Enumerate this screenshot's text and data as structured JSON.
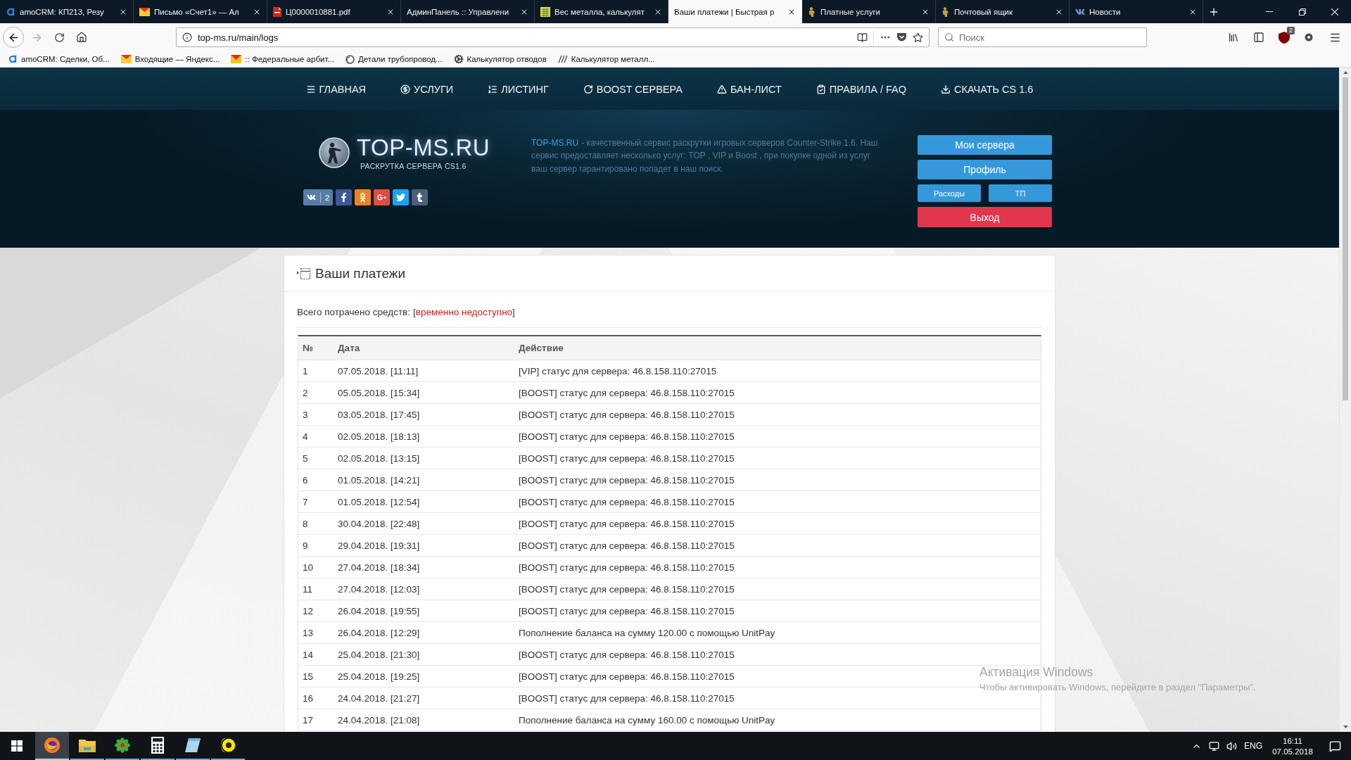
{
  "browser": {
    "tabs": [
      {
        "title": "amoCRM: КП213, Резу",
        "selected": false
      },
      {
        "title": "Письмо «Счет1» — Ал",
        "selected": false
      },
      {
        "title": "Ц0000010881.pdf",
        "selected": false
      },
      {
        "title": "АдминПанель :: Управлени",
        "selected": false
      },
      {
        "title": "Вес металла, калькулят",
        "selected": false
      },
      {
        "title": "Ваши платежи | Быстрая р",
        "selected": true
      },
      {
        "title": "Платные услуги",
        "selected": false
      },
      {
        "title": "Почтовый ящик",
        "selected": false
      },
      {
        "title": "Новости",
        "selected": false
      }
    ],
    "address": "top-ms.ru/main/logs",
    "search": {
      "placeholder": "Поиск"
    },
    "extension_badge": "2",
    "bookmarks": [
      "amoCRM: Сделки, Об...",
      "Входящие — Яндекс...",
      ":: Федеральные арбит...",
      "Детали трубопровод...",
      "Калькулятор отводов",
      "Калькулятор металл..."
    ]
  },
  "site": {
    "nav": [
      "ГЛАВНАЯ",
      "УСЛУГИ",
      "ЛИСТИНГ",
      "BOOST СЕРВЕРА",
      "БАН-ЛИСТ",
      "ПРАВИЛА / FAQ",
      "СКАЧАТЬ CS 1.6"
    ],
    "logo": {
      "title": "TOP-MS.RU",
      "subtitle": "РАСКРУТКА СЕРВЕРА CS1.6"
    },
    "share": {
      "count": "2"
    },
    "description": {
      "link": "TOP-MS.RU",
      "text": "- качественный сервис раскрутки игровых серверов Counter-Strike 1.6. Наш сервис предоставляет несколько услуг: TOP , VIP и Boost , при покупке одной из услуг ваш сервер гарантировано попадет в наш поиск."
    },
    "account_buttons": [
      {
        "label": "Мои сервера",
        "kind": "wide"
      },
      {
        "label": "Профиль",
        "kind": "wide"
      },
      {
        "label": "Расходы",
        "kind": "half"
      },
      {
        "label": "ТП",
        "kind": "half"
      },
      {
        "label": "Выход",
        "kind": "danger"
      }
    ],
    "payments": {
      "title": "Ваши платежи",
      "total": {
        "label": "Всего потрачено средств:",
        "open": "[",
        "value": "временно недоступно",
        "close": "]"
      },
      "table": {
        "columns": [
          "№",
          "Дата",
          "Действие"
        ],
        "rows": [
          [
            "1",
            "07.05.2018. [11:11]",
            "[VIP] статус для сервера: 46.8.158.110:27015"
          ],
          [
            "2",
            "05.05.2018. [15:34]",
            "[BOOST] статус для сервера: 46.8.158.110:27015"
          ],
          [
            "3",
            "03.05.2018. [17:45]",
            "[BOOST] статус для сервера: 46.8.158.110:27015"
          ],
          [
            "4",
            "02.05.2018. [18:13]",
            "[BOOST] статус для сервера: 46.8.158.110:27015"
          ],
          [
            "5",
            "02.05.2018. [13:15]",
            "[BOOST] статус для сервера: 46.8.158.110:27015"
          ],
          [
            "6",
            "01.05.2018. [14:21]",
            "[BOOST] статус для сервера: 46.8.158.110:27015"
          ],
          [
            "7",
            "01.05.2018. [12:54]",
            "[BOOST] статус для сервера: 46.8.158.110:27015"
          ],
          [
            "8",
            "30.04.2018. [22:48]",
            "[BOOST] статус для сервера: 46.8.158.110:27015"
          ],
          [
            "9",
            "29.04.2018. [19:31]",
            "[BOOST] статус для сервера: 46.8.158.110:27015"
          ],
          [
            "10",
            "27.04.2018. [18:34]",
            "[BOOST] статус для сервера: 46.8.158.110:27015"
          ],
          [
            "11",
            "27.04.2018. [12:03]",
            "[BOOST] статус для сервера: 46.8.158.110:27015"
          ],
          [
            "12",
            "26.04.2018. [19:55]",
            "[BOOST] статус для сервера: 46.8.158.110:27015"
          ],
          [
            "13",
            "26.04.2018. [12:29]",
            "Пополнение баланса на сумму 120.00 с помощью UnitPay"
          ],
          [
            "14",
            "25.04.2018. [21:30]",
            "[BOOST] статус для сервера: 46.8.158.110:27015"
          ],
          [
            "15",
            "25.04.2018. [19:25]",
            "[BOOST] статус для сервера: 46.8.158.110:27015"
          ],
          [
            "16",
            "24.04.2018. [21:27]",
            "[BOOST] статус для сервера: 46.8.158.110:27015"
          ],
          [
            "17",
            "24.04.2018. [21:08]",
            "Пополнение баланса на сумму 160.00 с помощью UnitPay"
          ]
        ]
      }
    }
  },
  "taskbar": {
    "apps": [
      {
        "active": true
      },
      {
        "active": false
      },
      {
        "active": false
      },
      {
        "active": false
      },
      {
        "active": false
      },
      {
        "active": false
      }
    ],
    "language": "ENG",
    "time": "16:11",
    "date": "07.05.2018"
  },
  "os_watermark": {
    "title": "Активация Windows",
    "text": "Чтобы активировать Windows, перейдите в раздел \"Параметры\"."
  }
}
